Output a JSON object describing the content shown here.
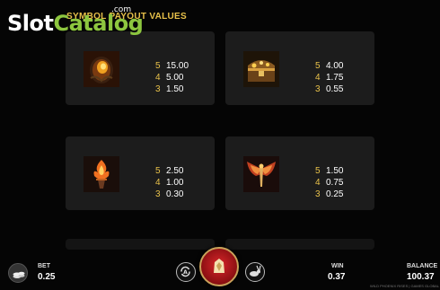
{
  "watermark": {
    "com": ".com",
    "slot": "Slot",
    "catalog": "Catalog"
  },
  "heading": "SYMBOL PAYOUT VALUES",
  "symbols": [
    {
      "icon": "dragon-egg-icon",
      "pays": [
        {
          "count": "5",
          "value": "15.00"
        },
        {
          "count": "4",
          "value": "5.00"
        },
        {
          "count": "3",
          "value": "1.50"
        }
      ]
    },
    {
      "icon": "treasure-chest-icon",
      "pays": [
        {
          "count": "5",
          "value": "4.00"
        },
        {
          "count": "4",
          "value": "1.75"
        },
        {
          "count": "3",
          "value": "0.55"
        }
      ]
    },
    {
      "icon": "fire-torch-icon",
      "pays": [
        {
          "count": "5",
          "value": "2.50"
        },
        {
          "count": "4",
          "value": "1.00"
        },
        {
          "count": "3",
          "value": "0.30"
        }
      ]
    },
    {
      "icon": "phoenix-wings-icon",
      "pays": [
        {
          "count": "5",
          "value": "1.50"
        },
        {
          "count": "4",
          "value": "0.75"
        },
        {
          "count": "3",
          "value": "0.25"
        }
      ]
    }
  ],
  "bottom": {
    "bet_label": "BET",
    "bet_value": "0.25",
    "win_label": "WIN",
    "win_value": "0.37",
    "balance_label": "BALANCE",
    "balance_value": "100.37",
    "footer_note": "WILD PHOENIX RISES | GAMES GLOBAL"
  },
  "colors": {
    "accent": "#e8c14a",
    "panel": "#1c1c1c",
    "spin": "#d8262a",
    "watermark_green": "#8dc63f"
  }
}
